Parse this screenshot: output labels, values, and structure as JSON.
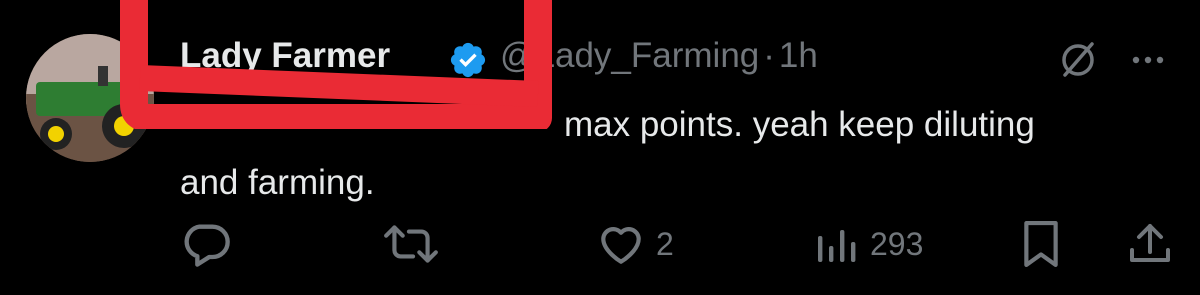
{
  "tweet": {
    "display_name": "Lady Farmer",
    "handle": "@Lady_Farming",
    "separator": "·",
    "time": "1h",
    "text_line1": "max points. yeah keep diluting",
    "text_line2": "and farming.",
    "verified_icon": "verified-badge-icon",
    "verified_color": "#1d9bf0"
  },
  "actions": {
    "reply_count": "",
    "retweet_count": "",
    "like_count": "2",
    "views_count": "293"
  },
  "colors": {
    "background": "#000000",
    "primary_text": "#e7e9ea",
    "secondary_text": "#71767b",
    "redaction": "#ea2b35"
  }
}
